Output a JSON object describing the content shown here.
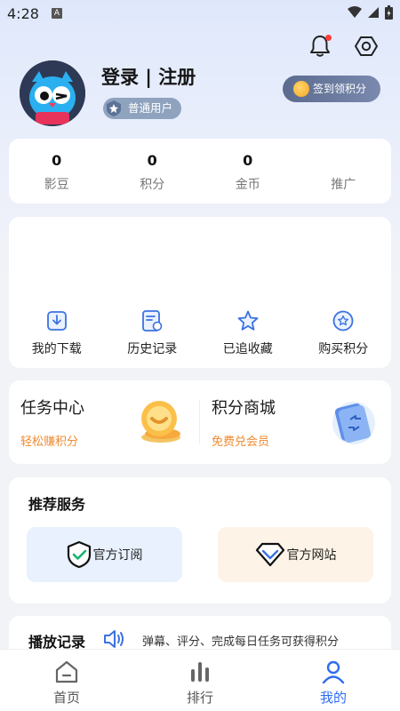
{
  "status_bar": {
    "time": "4:28",
    "badge": "A"
  },
  "header": {
    "login_title": "登录 | 注册",
    "user_level": "普通用户",
    "checkin_label": "签到领积分"
  },
  "stats": [
    {
      "value": "0",
      "label": "影豆"
    },
    {
      "value": "0",
      "label": "积分"
    },
    {
      "value": "0",
      "label": "金币"
    },
    {
      "value": "",
      "label": "推广"
    }
  ],
  "features": [
    {
      "label": "我的下载",
      "icon": "download-icon"
    },
    {
      "label": "历史记录",
      "icon": "history-icon"
    },
    {
      "label": "已追收藏",
      "icon": "star-icon"
    },
    {
      "label": "购买积分",
      "icon": "points-icon"
    }
  ],
  "tasks": {
    "left": {
      "title": "任务中心",
      "subtitle": "轻松赚积分"
    },
    "right": {
      "title": "积分商城",
      "subtitle": "免费兑会员"
    }
  },
  "services": {
    "title": "推荐服务",
    "items": [
      {
        "label": "官方订阅"
      },
      {
        "label": "官方网站"
      }
    ]
  },
  "history": {
    "title": "播放记录",
    "tip": "弹幕、评分、完成每日任务可获得积分"
  },
  "bottom_nav": [
    {
      "label": "首页",
      "icon": "home-icon",
      "active": false
    },
    {
      "label": "排行",
      "icon": "ranking-icon",
      "active": false
    },
    {
      "label": "我的",
      "icon": "profile-icon",
      "active": true
    }
  ],
  "colors": {
    "accent_blue": "#2f6bf2",
    "task_orange": "#ee8a30",
    "notification_red": "#ff3b3b"
  }
}
